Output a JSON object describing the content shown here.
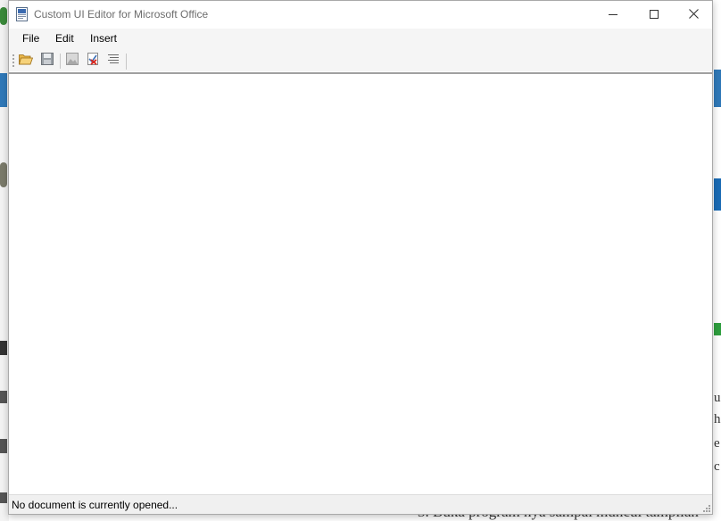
{
  "window": {
    "title": "Custom UI Editor for Microsoft Office",
    "controls": {
      "minimize_icon": "minimize-icon",
      "maximize_icon": "maximize-icon",
      "close_icon": "close-icon"
    }
  },
  "menu": {
    "items": [
      {
        "label": "File"
      },
      {
        "label": "Edit"
      },
      {
        "label": "Insert"
      }
    ]
  },
  "toolbar": {
    "buttons": [
      {
        "name": "open-button",
        "icon": "folder-open-icon"
      },
      {
        "name": "save-button",
        "icon": "save-disk-icon"
      },
      {
        "name": "insert-icons-button",
        "icon": "image-icon"
      },
      {
        "name": "validate-button",
        "icon": "validate-check-icon"
      },
      {
        "name": "format-button",
        "icon": "format-lines-icon"
      }
    ]
  },
  "status": {
    "text": "No document is currently opened..."
  },
  "background": {
    "bottom_text": "3. Buka program nya sampai muncul tampilan",
    "right_letters": [
      "u",
      "h",
      "e",
      "c"
    ]
  },
  "colors": {
    "window_border": "#a9a9a9",
    "menubar_bg": "#f5f5f5",
    "statusbar_bg": "#f0f0f0",
    "title_text": "#6d6d6d"
  }
}
